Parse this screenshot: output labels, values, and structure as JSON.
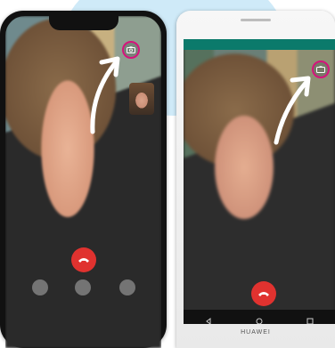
{
  "background": {
    "accent": "#cfeaf8"
  },
  "iphone": {
    "device": "iphone",
    "call_icons": {
      "switch_camera": "switch-camera-icon",
      "hang_up": "hang-up-icon"
    },
    "highlight_color": "#d6137c"
  },
  "huawei": {
    "brand_label": "HUAWEI",
    "status_bar_color": "#0b7a6b",
    "call_icons": {
      "switch_camera": "switch-camera-icon",
      "hang_up": "hang-up-icon"
    },
    "nav_icons": [
      "back-icon",
      "home-icon",
      "recents-icon"
    ]
  },
  "annotation": {
    "arrow_color": "#ffffff"
  }
}
